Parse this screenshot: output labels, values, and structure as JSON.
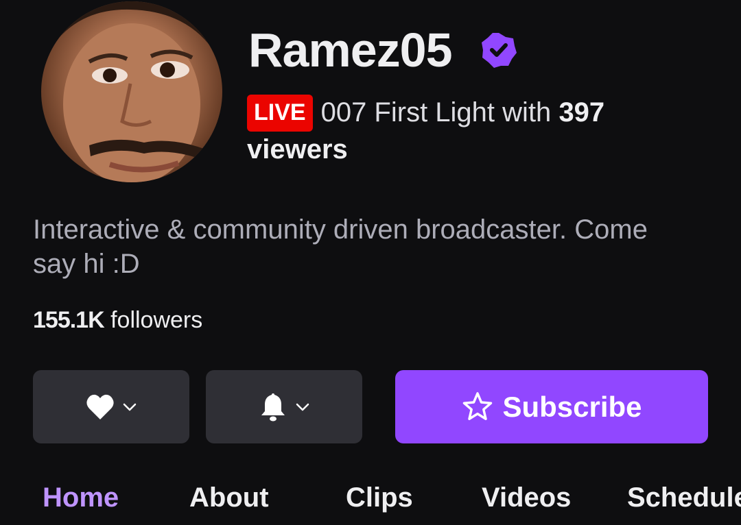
{
  "channel": {
    "name": "Ramez05",
    "verified_icon": "verified-badge-icon",
    "avatar_icon": "avatar"
  },
  "live": {
    "badge": "LIVE",
    "game": "007 First Light",
    "with_text": "with",
    "viewer_count": "397",
    "viewers_label": "viewers"
  },
  "bio": "Interactive & community driven broadcaster. Come say hi :D",
  "followers": {
    "count": "155.1K",
    "label": "followers"
  },
  "actions": {
    "follow_icon": "heart-icon",
    "notify_icon": "bell-icon",
    "subscribe_label": "Subscribe",
    "subscribe_icon": "star-icon"
  },
  "tabs": [
    {
      "label": "Home",
      "active": true
    },
    {
      "label": "About",
      "active": false
    },
    {
      "label": "Clips",
      "active": false
    },
    {
      "label": "Videos",
      "active": false
    },
    {
      "label": "Schedule",
      "active": false
    }
  ],
  "colors": {
    "background": "#0e0e10",
    "accent": "#9147ff",
    "active_tab": "#bf94ff",
    "live_red": "#eb0400",
    "button_bg": "#2f2f35",
    "muted_text": "#adadb8"
  }
}
